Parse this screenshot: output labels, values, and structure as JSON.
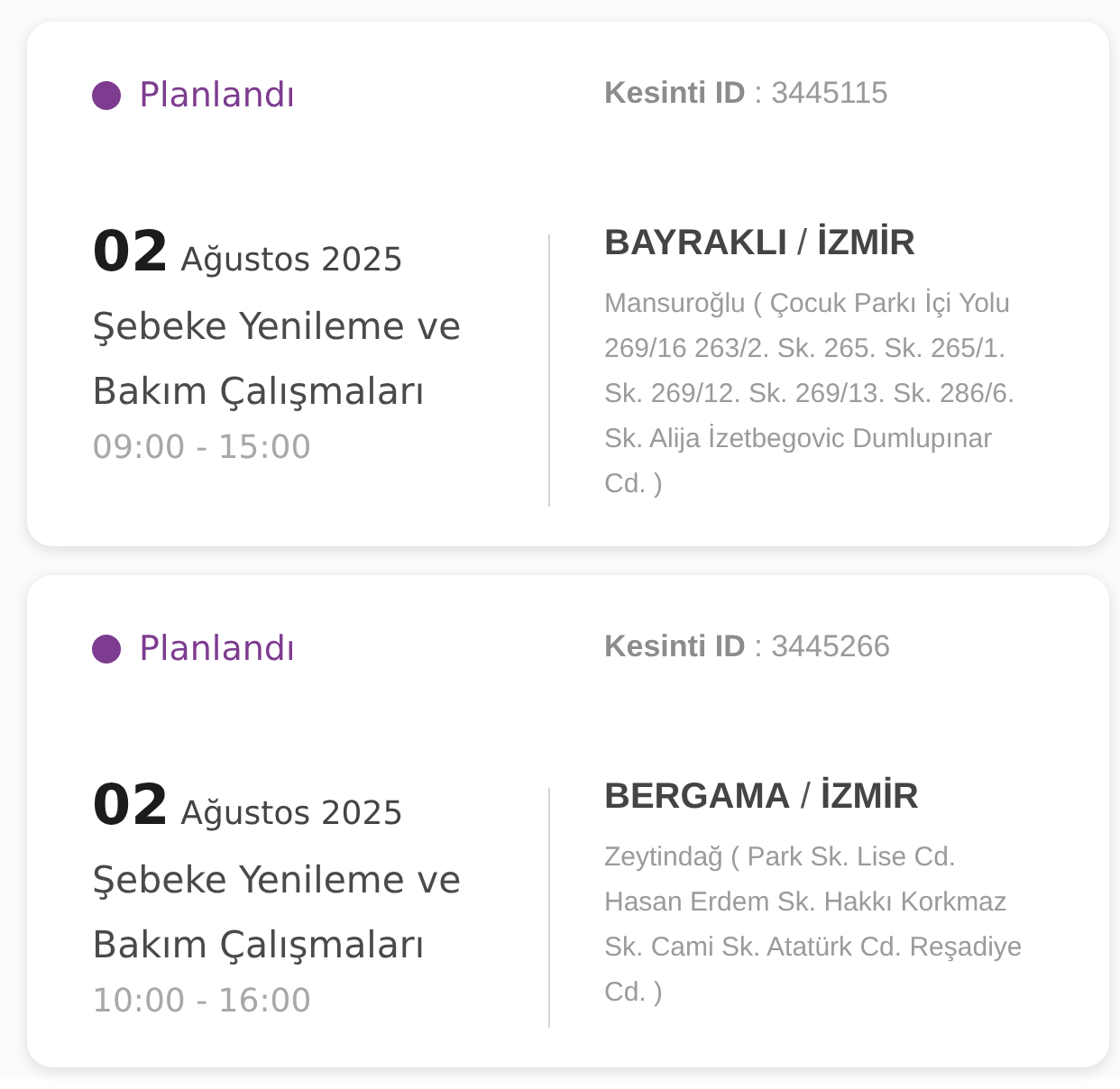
{
  "outages": [
    {
      "status": {
        "label": "Planlandı",
        "color": "#7d3c8f"
      },
      "outage_id": "**Kesinti ID** : 3445115",
      "day": "02",
      "month_year": "Ağustos 2025",
      "title": "Şebeke Yenileme ve Bakım Çalışmaları",
      "time": "09:00 - 15:00",
      "location": "**BAYRAKLI** / **İZMİR**",
      "address": "Mansuroğlu ( Çocuk Parkı İçi Yolu 269/16 263/2. Sk. 265. Sk. 265/1. Sk. 269/12. Sk. 269/13. Sk. 286/6. Sk. Alija İzetbegovic Dumlupınar Cd. )"
    },
    {
      "status": {
        "label": "Planlandı",
        "color": "#7d3c8f"
      },
      "outage_id": "**Kesinti ID** : 3445266",
      "day": "02",
      "month_year": "Ağustos 2025",
      "title": "Şebeke Yenileme ve Bakım Çalışmaları",
      "time": "10:00 - 16:00",
      "location": "**BERGAMA** / **İZMİR**",
      "address": "Zeytindağ ( Park Sk. Lise Cd. Hasan Erdem Sk. Hakkı Korkmaz Sk. Cami Sk. Atatürk Cd. Reşadiye Cd. )"
    }
  ]
}
